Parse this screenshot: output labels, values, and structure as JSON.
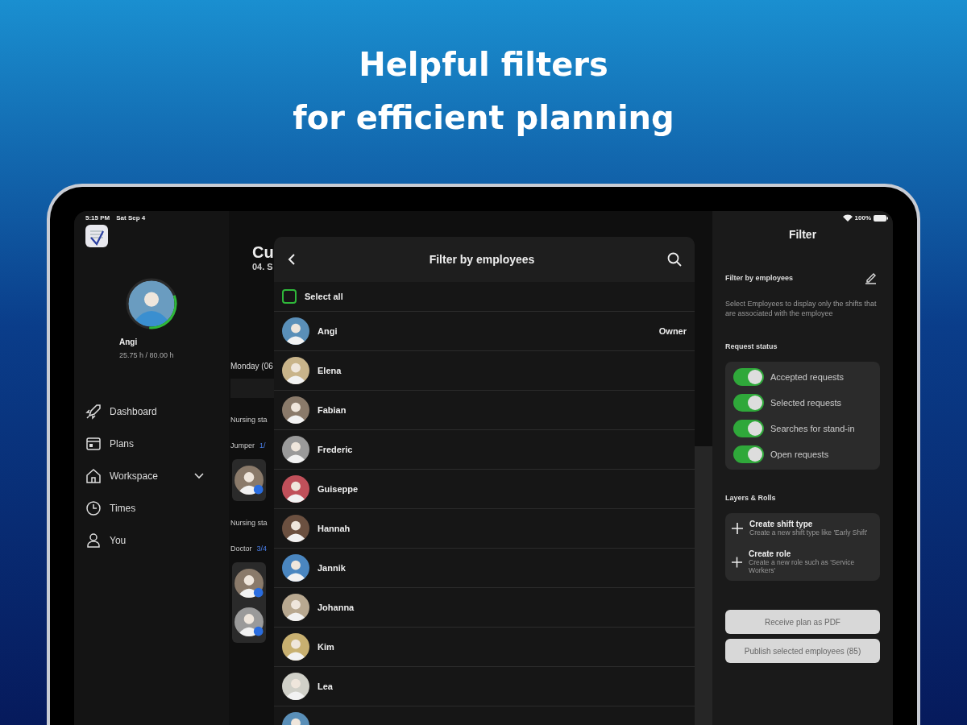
{
  "headline": [
    "Helpful filters",
    "for efficient planning"
  ],
  "status_bar": {
    "time": "5:15 PM",
    "date": "Sat Sep 4",
    "battery": "100%"
  },
  "profile": {
    "name": "Angi",
    "hours": "25.75 h / 80.00 h",
    "level": 0.32
  },
  "nav": [
    {
      "label": "Dashboard"
    },
    {
      "label": "Plans"
    },
    {
      "label": "Workspace",
      "expanded": false
    },
    {
      "label": "Times"
    },
    {
      "label": "You"
    }
  ],
  "plan": {
    "title": "Cu",
    "date": "04. S",
    "day": "Monday (06",
    "groups": [
      {
        "label": "Nursing sta"
      },
      {
        "label": "Jumper",
        "count": "1/",
        "members": [
          {
            "badge": true
          }
        ]
      },
      {
        "label": "Nursing sta"
      },
      {
        "label": "Doctor",
        "count": "3/4",
        "members": [
          {
            "badge": true
          },
          {
            "badge": true
          }
        ]
      }
    ]
  },
  "employee_filter": {
    "title": "Filter by employees",
    "select_all": {
      "label": "Select all",
      "checked": false
    },
    "employees": [
      {
        "name": "Angi",
        "role": "Owner"
      },
      {
        "name": "Elena"
      },
      {
        "name": "Fabian"
      },
      {
        "name": "Frederic"
      },
      {
        "name": "Guiseppe"
      },
      {
        "name": "Hannah"
      },
      {
        "name": "Jannik"
      },
      {
        "name": "Johanna"
      },
      {
        "name": "Kim"
      },
      {
        "name": "Lea"
      }
    ]
  },
  "filter_panel": {
    "title": "Filter",
    "employees_heading": "Filter by employees",
    "description": "Select Employees to display only the shifts that are associated with the employee",
    "request_heading": "Request status",
    "toggles": [
      {
        "label": "Accepted requests",
        "on": true
      },
      {
        "label": "Selected requests",
        "on": true
      },
      {
        "label": "Searches for stand-in",
        "on": true
      },
      {
        "label": "Open requests",
        "on": true
      }
    ],
    "layers_heading": "Layers & Rolls",
    "actions": [
      {
        "title": "Create shift type",
        "subtitle": "Create a new shift type like 'Early Shift'"
      },
      {
        "title": "Create role",
        "subtitle": "Create a new role such as 'Service Workers'"
      }
    ],
    "buttons": [
      "Receive plan as PDF",
      "Publish selected employees (85)"
    ]
  }
}
